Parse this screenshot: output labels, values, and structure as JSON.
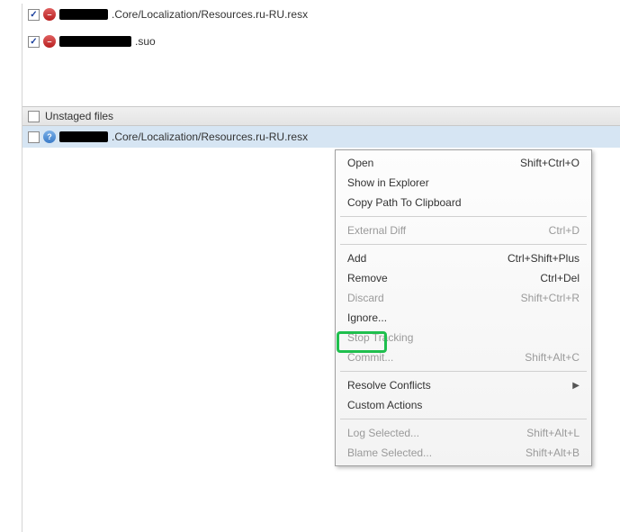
{
  "staged": {
    "files": [
      {
        "path_suffix": ".Core/Localization/Resources.ru-RU.resx",
        "redact_w": 54
      },
      {
        "path_suffix": ".suo",
        "redact_w": 80
      }
    ]
  },
  "unstaged": {
    "title": "Unstaged files",
    "files": [
      {
        "path_suffix": ".Core/Localization/Resources.ru-RU.resx",
        "redact_w": 54
      }
    ]
  },
  "menu": {
    "open": {
      "label": "Open",
      "shortcut": "Shift+Ctrl+O"
    },
    "explorer": {
      "label": "Show in Explorer"
    },
    "copypath": {
      "label": "Copy Path To Clipboard"
    },
    "extdiff": {
      "label": "External Diff",
      "shortcut": "Ctrl+D"
    },
    "add": {
      "label": "Add",
      "shortcut": "Ctrl+Shift+Plus"
    },
    "remove": {
      "label": "Remove",
      "shortcut": "Ctrl+Del"
    },
    "discard": {
      "label": "Discard",
      "shortcut": "Shift+Ctrl+R"
    },
    "ignore": {
      "label": "Ignore..."
    },
    "stoptracking": {
      "label": "Stop Tracking"
    },
    "commit": {
      "label": "Commit...",
      "shortcut": "Shift+Alt+C"
    },
    "resolve": {
      "label": "Resolve Conflicts"
    },
    "custom": {
      "label": "Custom Actions"
    },
    "log": {
      "label": "Log Selected...",
      "shortcut": "Shift+Alt+L"
    },
    "blame": {
      "label": "Blame Selected...",
      "shortcut": "Shift+Alt+B"
    }
  }
}
